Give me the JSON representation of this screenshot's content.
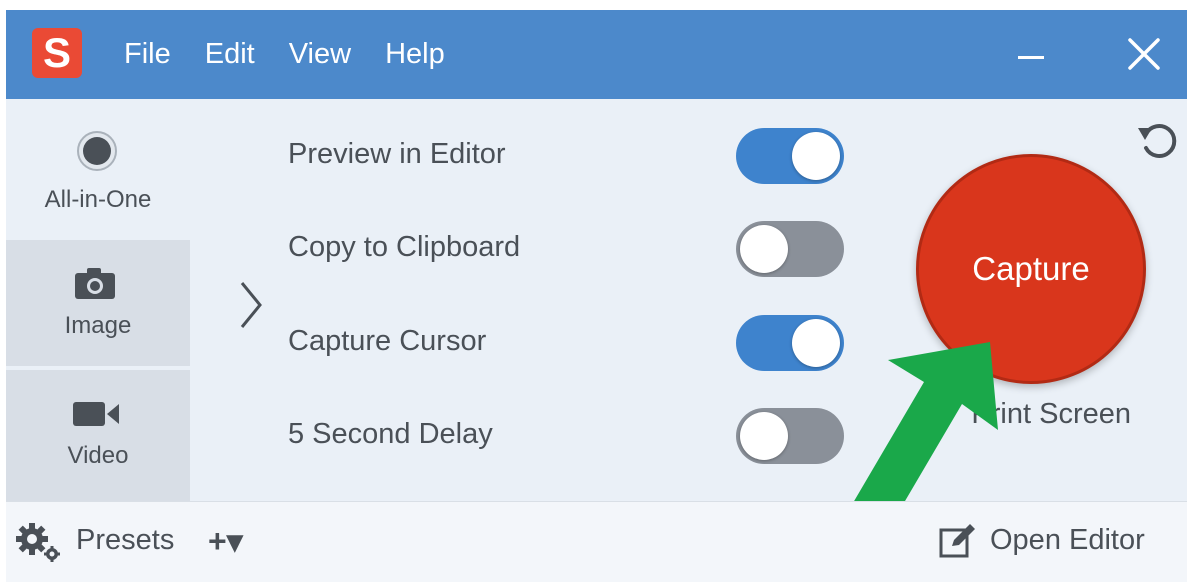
{
  "app": {
    "logo_letter": "S"
  },
  "menu": [
    "File",
    "Edit",
    "View",
    "Help"
  ],
  "sidebar": {
    "modes": [
      {
        "label": "All-in-One",
        "icon": "record-icon",
        "selected": true
      },
      {
        "label": "Image",
        "icon": "camera-icon",
        "selected": false
      },
      {
        "label": "Video",
        "icon": "video-camera-icon",
        "selected": false
      }
    ]
  },
  "options": [
    {
      "label": "Preview in Editor",
      "on": true
    },
    {
      "label": "Copy to Clipboard",
      "on": false
    },
    {
      "label": "Capture Cursor",
      "on": true
    },
    {
      "label": "5 Second Delay",
      "on": false
    }
  ],
  "capture": {
    "label": "Capture",
    "mode_text": "Print Screen"
  },
  "bottom": {
    "presets_label": "Presets",
    "add_label": "+▾",
    "open_editor_label": "Open Editor"
  },
  "colors": {
    "titlebar": "#4c89cb",
    "toggle_on": "#3e83cd",
    "toggle_off": "#8a9099",
    "capture": "#d9361c",
    "annotation_arrow": "#1aa84a"
  }
}
